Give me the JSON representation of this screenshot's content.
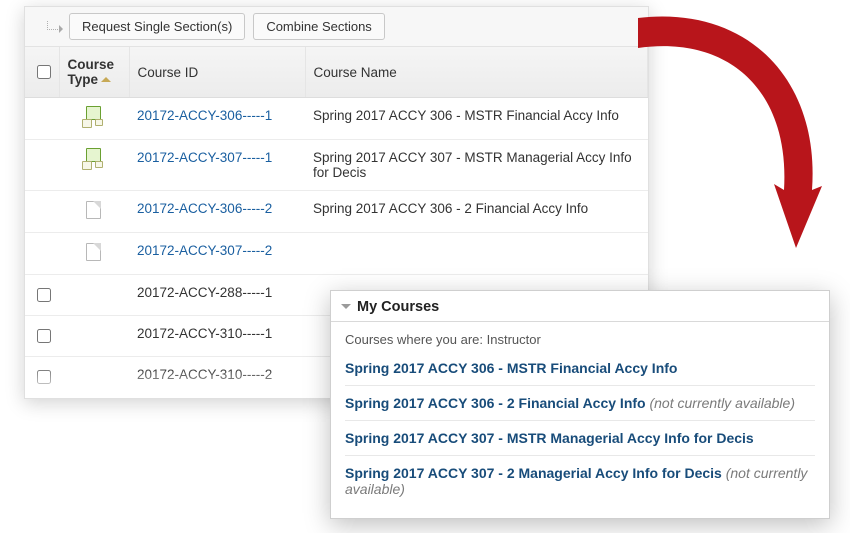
{
  "toolbar": {
    "request_label": "Request Single Section(s)",
    "combine_label": "Combine Sections"
  },
  "columns": {
    "type": "Course Type",
    "id": "Course ID",
    "name": "Course Name"
  },
  "rows": [
    {
      "icon": "master",
      "checkbox": false,
      "id": "20172-ACCY-306-----1",
      "id_link": true,
      "name": "Spring 2017 ACCY 306 - MSTR Financial Accy Info"
    },
    {
      "icon": "master",
      "checkbox": false,
      "id": "20172-ACCY-307-----1",
      "id_link": true,
      "name": "Spring 2017 ACCY 307 - MSTR Managerial Accy Info for Decis"
    },
    {
      "icon": "doc",
      "checkbox": false,
      "id": "20172-ACCY-306-----2",
      "id_link": true,
      "name": "Spring 2017 ACCY 306 - 2 Financial Accy Info"
    },
    {
      "icon": "doc",
      "checkbox": false,
      "id": "20172-ACCY-307-----2",
      "id_link": true,
      "name": ""
    },
    {
      "icon": "",
      "checkbox": true,
      "id": "20172-ACCY-288-----1",
      "id_link": false,
      "name": ""
    },
    {
      "icon": "",
      "checkbox": true,
      "id": "20172-ACCY-310-----1",
      "id_link": false,
      "name": ""
    },
    {
      "icon": "",
      "checkbox": true,
      "id": "20172-ACCY-310-----2",
      "id_link": false,
      "name": ""
    }
  ],
  "my_courses": {
    "title": "My Courses",
    "subtitle": "Courses where you are: Instructor",
    "na_text": "(not currently available)",
    "items": [
      {
        "label": "Spring 2017 ACCY 306 - MSTR Financial Accy Info",
        "available": true
      },
      {
        "label": "Spring 2017 ACCY 306 - 2 Financial Accy Info",
        "available": false
      },
      {
        "label": "Spring 2017 ACCY 307 - MSTR Managerial Accy Info for Decis",
        "available": true
      },
      {
        "label": "Spring 2017 ACCY 307 - 2 Managerial Accy Info for Decis",
        "available": false
      }
    ]
  }
}
